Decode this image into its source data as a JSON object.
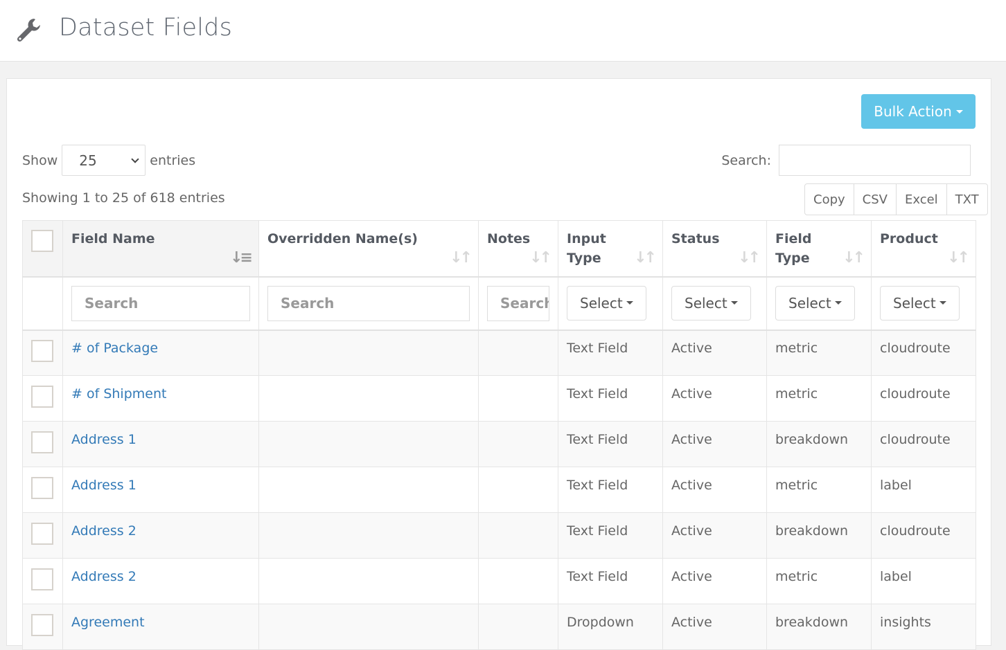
{
  "header": {
    "title": "Dataset Fields",
    "icon": "wrench-icon"
  },
  "toolbar": {
    "bulk_action_label": "Bulk Action"
  },
  "length": {
    "show_label": "Show",
    "value": "25",
    "entries_label": "entries"
  },
  "search": {
    "label": "Search:",
    "value": ""
  },
  "info": "Showing 1 to 25 of 618 entries",
  "export_buttons": [
    "Copy",
    "CSV",
    "Excel",
    "TXT"
  ],
  "columns": [
    {
      "label": "Field Name",
      "sort": "ascending"
    },
    {
      "label": "Overridden Name(s)",
      "sort": "none"
    },
    {
      "label": "Notes",
      "sort": "none"
    },
    {
      "label": "Input Type",
      "sort": "none"
    },
    {
      "label": "Status",
      "sort": "none"
    },
    {
      "label": "Field Type",
      "sort": "none"
    },
    {
      "label": "Product",
      "sort": "none"
    }
  ],
  "filters": {
    "field_name_placeholder": "Search",
    "overridden_placeholder": "Search",
    "notes_placeholder": "Search",
    "input_type_select": "Select",
    "status_select": "Select",
    "field_type_select": "Select",
    "product_select": "Select"
  },
  "rows": [
    {
      "field_name": "# of Package",
      "overridden": "",
      "notes": "",
      "input_type": "Text Field",
      "status": "Active",
      "field_type": "metric",
      "product": "cloudroute"
    },
    {
      "field_name": "# of Shipment",
      "overridden": "",
      "notes": "",
      "input_type": "Text Field",
      "status": "Active",
      "field_type": "metric",
      "product": "cloudroute"
    },
    {
      "field_name": "Address 1",
      "overridden": "",
      "notes": "",
      "input_type": "Text Field",
      "status": "Active",
      "field_type": "breakdown",
      "product": "cloudroute"
    },
    {
      "field_name": "Address 1",
      "overridden": "",
      "notes": "",
      "input_type": "Text Field",
      "status": "Active",
      "field_type": "metric",
      "product": "label"
    },
    {
      "field_name": "Address 2",
      "overridden": "",
      "notes": "",
      "input_type": "Text Field",
      "status": "Active",
      "field_type": "breakdown",
      "product": "cloudroute"
    },
    {
      "field_name": "Address 2",
      "overridden": "",
      "notes": "",
      "input_type": "Text Field",
      "status": "Active",
      "field_type": "metric",
      "product": "label"
    },
    {
      "field_name": "Agreement",
      "overridden": "",
      "notes": "",
      "input_type": "Dropdown",
      "status": "Active",
      "field_type": "breakdown",
      "product": "insights"
    }
  ],
  "colors": {
    "accent": "#62c5e8",
    "link": "#337ab7"
  }
}
